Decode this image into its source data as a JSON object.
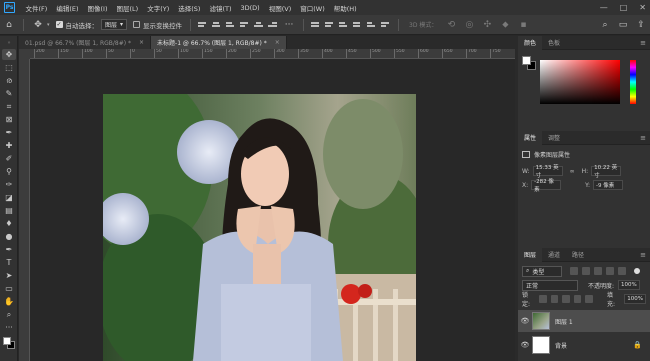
{
  "app": {
    "logo": "Ps"
  },
  "menu": [
    "文件(F)",
    "编辑(E)",
    "图像(I)",
    "图层(L)",
    "文字(Y)",
    "选择(S)",
    "滤镜(T)",
    "3D(D)",
    "视图(V)",
    "窗口(W)",
    "帮助(H)"
  ],
  "options": {
    "auto_select_label": "自动选择：",
    "auto_select_value": "图层",
    "show_transform_label": "显示变换控件",
    "mode_3d": "3D 模式："
  },
  "tabs": [
    {
      "label": "01.psd @ 66.7% (图层 1, RGB/8#) *",
      "close": "×"
    },
    {
      "label": "未标题-1 @ 66.7% (图层 1, RGB/8#) *",
      "close": "×"
    }
  ],
  "ruler": {
    "labels": [
      "200",
      "150",
      "100",
      "50",
      "0",
      "50",
      "100",
      "150",
      "200",
      "250",
      "300",
      "350",
      "400",
      "450",
      "500",
      "550",
      "600",
      "650",
      "700",
      "750"
    ]
  },
  "color_panel": {
    "tabs": [
      "颜色",
      "色板"
    ],
    "fg": "#ffffff",
    "bg": "#000000"
  },
  "properties": {
    "tabs": [
      "属性",
      "调整"
    ],
    "title": "像素图层属性",
    "w_label": "W:",
    "w_value": "15.33 英寸",
    "h_label": "H:",
    "h_value": "10.22 英寸",
    "x_label": "X:",
    "x_value": "-282 像素",
    "y_label": "Y:",
    "y_value": "-9 像素"
  },
  "layers_panel": {
    "tabs": [
      "图层",
      "通道",
      "路径"
    ],
    "filter": "类型",
    "blend_mode": "正常",
    "opacity_label": "不透明度:",
    "opacity_value": "100%",
    "lock_label": "锁定:",
    "fill_label": "填充:",
    "fill_value": "100%",
    "layers": [
      {
        "name": "图层 1",
        "selected": true
      },
      {
        "name": "背景",
        "selected": false,
        "locked": true
      }
    ]
  }
}
